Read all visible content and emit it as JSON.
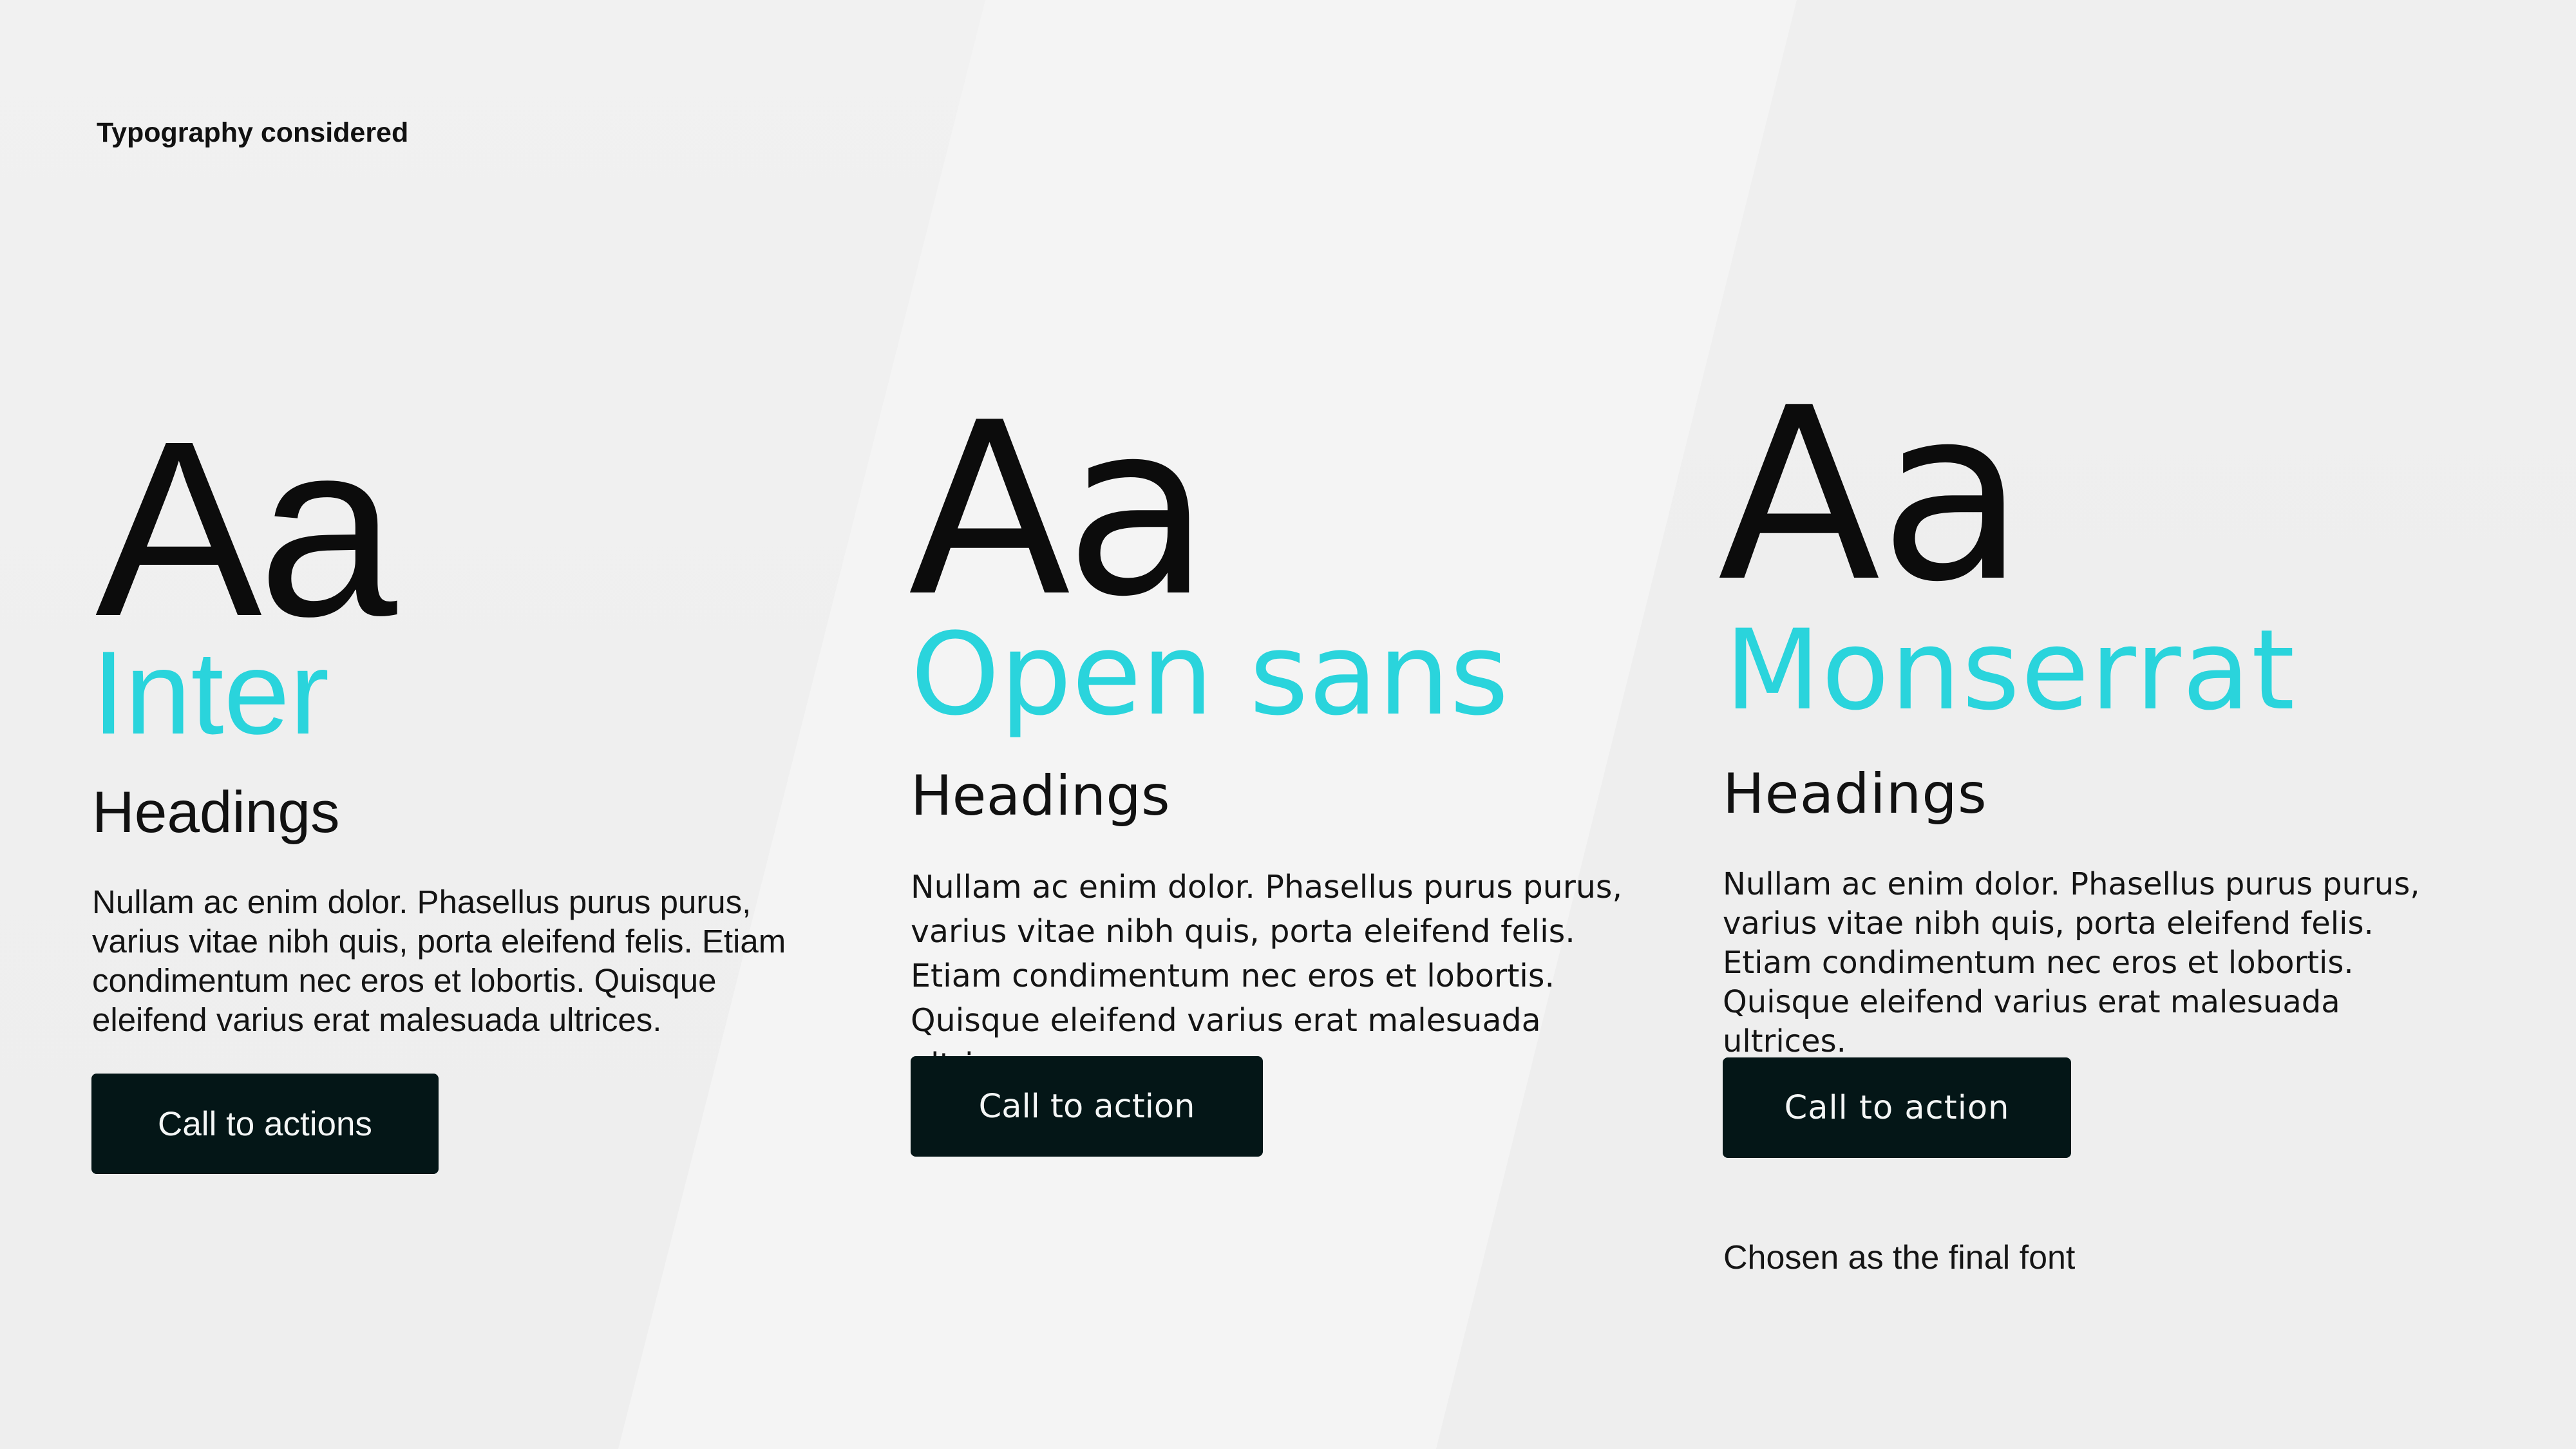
{
  "page": {
    "title": "Typography considered",
    "note": "Chosen as the final font"
  },
  "colors": {
    "accent": "#2ad4dc",
    "button_background": "#041617",
    "button_text": "#f4f6f6",
    "background": "#efefef",
    "text": "#111111"
  },
  "fonts": [
    {
      "sample": "Aa",
      "name": "Inter",
      "heading": "Headings",
      "body": "Nullam ac enim dolor. Phasellus purus purus, varius vitae nibh quis, porta eleifend felis. Etiam condimentum nec eros et lobortis. Quisque eleifend varius erat malesuada ultrices.",
      "cta_label": "Call to actions"
    },
    {
      "sample": "Aa",
      "name": "Open sans",
      "heading": "Headings",
      "body": "Nullam ac enim dolor. Phasellus purus purus, varius vitae nibh quis, porta eleifend felis. Etiam condimentum nec eros et lobortis. Quisque eleifend varius erat malesuada ultrices.",
      "cta_label": "Call to action"
    },
    {
      "sample": "Aa",
      "name": "Monserrat",
      "heading": "Headings",
      "body": "Nullam ac enim dolor. Phasellus purus purus, varius vitae nibh quis, porta eleifend felis. Etiam condimentum nec eros et lobortis. Quisque eleifend varius erat malesuada ultrices.",
      "cta_label": "Call to action"
    }
  ]
}
